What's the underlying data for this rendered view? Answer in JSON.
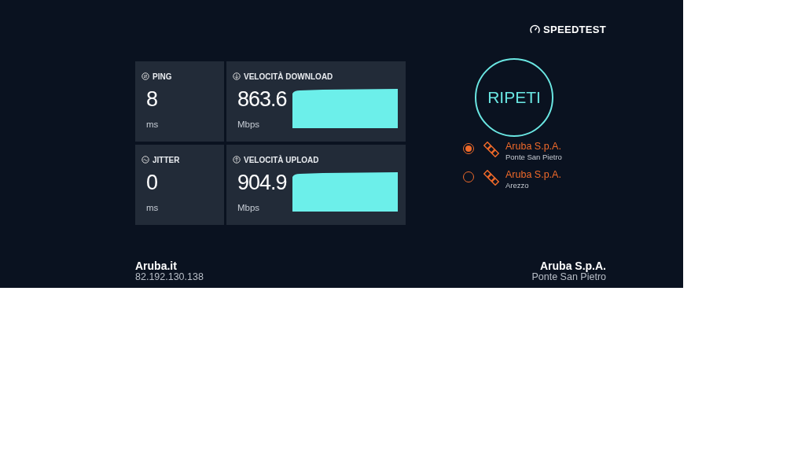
{
  "brand": {
    "name": "SPEEDTEST"
  },
  "metrics": [
    {
      "kind": "small",
      "label": "PING",
      "value": "8",
      "unit": "ms"
    },
    {
      "kind": "graph",
      "label": "VELOCITÀ DOWNLOAD",
      "value": "863.6",
      "unit": "Mbps"
    },
    {
      "kind": "small",
      "label": "JITTER",
      "value": "0",
      "unit": "ms"
    },
    {
      "kind": "graph",
      "label": "VELOCITÀ UPLOAD",
      "value": "904.9",
      "unit": "Mbps"
    }
  ],
  "action": {
    "label": "RIPETI"
  },
  "servers": [
    {
      "name": "Aruba S.p.A.",
      "location": "Ponte San Pietro",
      "selected": true
    },
    {
      "name": "Aruba S.p.A.",
      "location": "Arezzo",
      "selected": false
    }
  ],
  "footer": {
    "isp": "Aruba.it",
    "ip": "82.192.130.138",
    "server": "Aruba S.p.A.",
    "location": "Ponte San Pietro"
  }
}
